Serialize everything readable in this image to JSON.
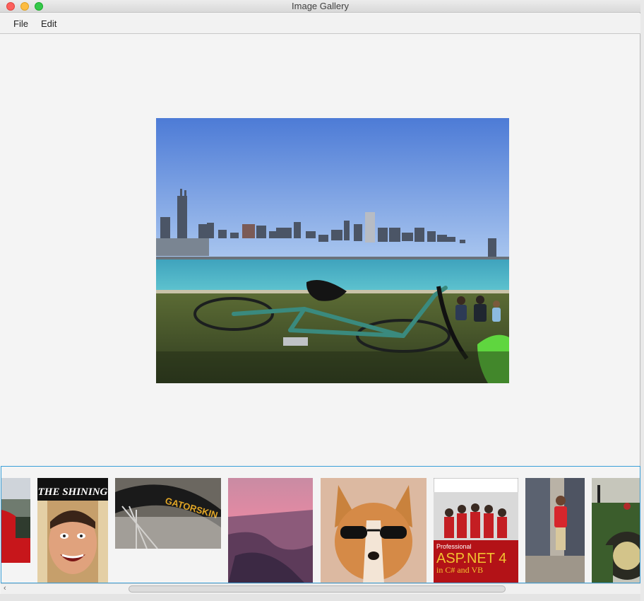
{
  "window": {
    "title": "Image Gallery"
  },
  "menu": {
    "file": "File",
    "edit": "Edit"
  },
  "main_image": {
    "subject": "city-skyline-with-bicycle"
  },
  "thumbnails": [
    {
      "subject": "partial-photo-red"
    },
    {
      "subject": "the-shining-poster",
      "caption": "THE SHINING"
    },
    {
      "subject": "bicycle-tire",
      "caption": "GATORSKIN"
    },
    {
      "subject": "canyon-sunset"
    },
    {
      "subject": "corgi-sunglasses"
    },
    {
      "subject": "asp-net-book",
      "caption_line1": "Professional",
      "caption_line2": "ASP.NET 4",
      "caption_line3": "in C# and VB"
    },
    {
      "subject": "child-by-car"
    },
    {
      "subject": "tractor"
    }
  ],
  "scrollbar": {
    "left_arrow": "‹"
  },
  "colors": {
    "strip_border": "#3a9fd8",
    "close": "#fc605c",
    "minimize": "#fdbc40",
    "maximize": "#34c84a"
  }
}
